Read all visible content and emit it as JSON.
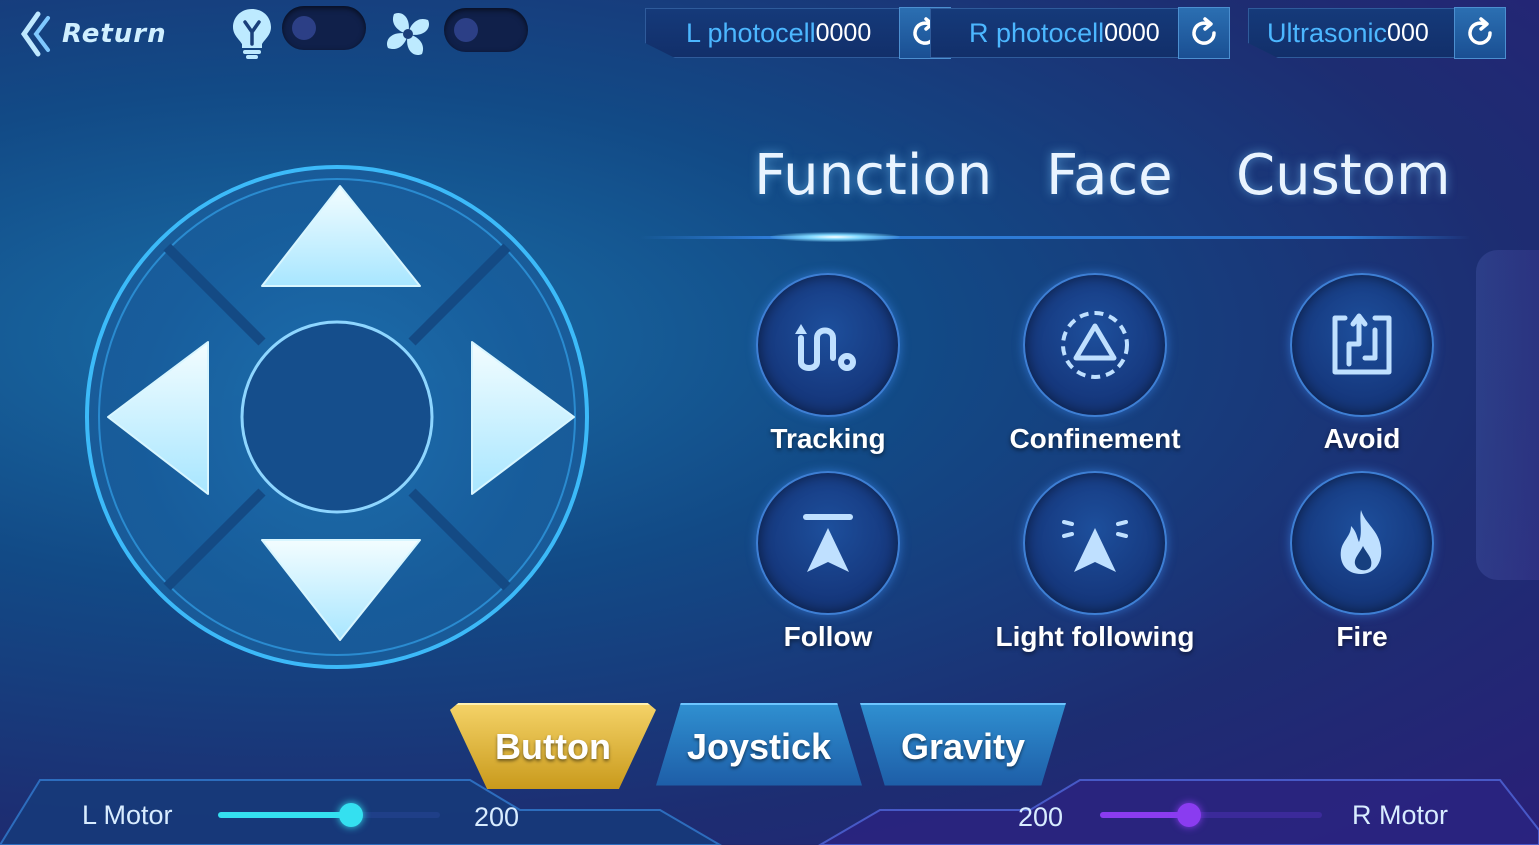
{
  "header": {
    "return_label": "Return",
    "light_toggle_on": false,
    "fan_toggle_on": false,
    "sensors": [
      {
        "label": "L photocell",
        "value": "0000"
      },
      {
        "label": "R photocell",
        "value": "0000"
      },
      {
        "label": "Ultrasonic",
        "value": "000"
      }
    ]
  },
  "tabs": [
    "Function",
    "Face",
    "Custom"
  ],
  "active_tab": "Function",
  "functions": [
    {
      "label": "Tracking",
      "icon": "tracking-icon"
    },
    {
      "label": "Confinement",
      "icon": "confinement-icon"
    },
    {
      "label": "Avoid",
      "icon": "avoid-icon"
    },
    {
      "label": "Follow",
      "icon": "follow-icon"
    },
    {
      "label": "Light following",
      "icon": "light-following-icon"
    },
    {
      "label": "Fire",
      "icon": "fire-icon"
    }
  ],
  "modes": [
    "Button",
    "Joystick",
    "Gravity"
  ],
  "active_mode": "Button",
  "motors": {
    "left": {
      "label": "L Motor",
      "value": "200",
      "level": 0.6,
      "color": "#34e0f0"
    },
    "right": {
      "label": "R Motor",
      "value": "200",
      "level": 0.4,
      "color": "#8a3cf0"
    }
  },
  "colors": {
    "accent": "#4cb7ff",
    "active_mode": "#e8bb3a"
  }
}
